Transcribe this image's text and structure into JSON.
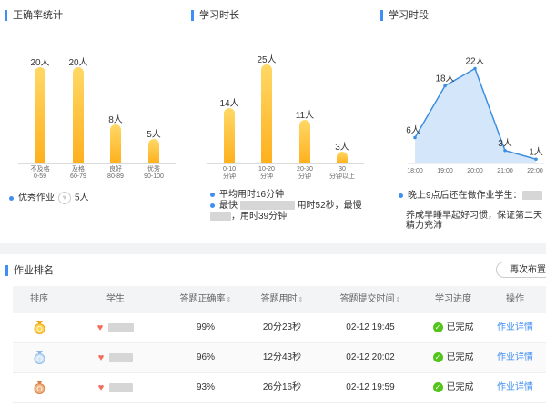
{
  "stats": {
    "accuracy": {
      "title": "正确率统计",
      "chart_data": {
        "type": "bar",
        "categories": [
          [
            "不及格",
            "0-59"
          ],
          [
            "及格",
            "60-79"
          ],
          [
            "良好",
            "80-89"
          ],
          [
            "优秀",
            "90-100"
          ]
        ],
        "values": [
          20,
          20,
          8,
          5
        ],
        "labels": [
          "20人",
          "20人",
          "8人",
          "5人"
        ],
        "ylim": [
          0,
          22
        ]
      },
      "footer": {
        "label": "优秀作业",
        "count": "5人"
      }
    },
    "duration": {
      "title": "学习时长",
      "chart_data": {
        "type": "bar",
        "categories": [
          [
            "0-10",
            "分钟"
          ],
          [
            "10-20",
            "分钟"
          ],
          [
            "20-30",
            "分钟"
          ],
          [
            "30",
            "分钟以上"
          ]
        ],
        "values": [
          14,
          25,
          11,
          3
        ],
        "labels": [
          "14人",
          "25人",
          "11人",
          "3人"
        ],
        "ylim": [
          0,
          27
        ]
      },
      "footer": {
        "average": "平均用时16分钟",
        "fastest_prefix": "最快",
        "fastest_time": "用时52秒，最慢",
        "slowest_time": "，用时39分钟"
      }
    },
    "timeslot": {
      "title": "学习时段",
      "chart_data": {
        "type": "area",
        "x": [
          "18:00",
          "19:00",
          "20:00",
          "21:00",
          "22:00"
        ],
        "values": [
          6,
          18,
          22,
          3,
          1
        ],
        "labels": [
          "6人",
          "18人",
          "22人",
          "3人",
          "1人"
        ],
        "ylim": [
          0,
          24
        ]
      },
      "footer": {
        "late_label": "晚上9点后还在做作业学生：",
        "tip": "养成早睡早起好习惯，保证第二天精力充沛"
      }
    }
  },
  "ranking": {
    "title": "作业排名",
    "reassign_label": "再次布置",
    "headers": [
      "排序",
      "学生",
      "答题正确率",
      "答题用时",
      "答题提交时间",
      "学习进度",
      "操作"
    ],
    "sort_mark": "⇕",
    "rows": [
      {
        "medal": "gold-medal-icon",
        "accuracy": "99%",
        "duration": "20分23秒",
        "submitted": "02-12 19:45",
        "progress": "已完成",
        "action": "作业详情"
      },
      {
        "medal": "silver-medal-icon",
        "accuracy": "96%",
        "duration": "12分43秒",
        "submitted": "02-12 20:02",
        "progress": "已完成",
        "action": "作业详情"
      },
      {
        "medal": "bronze-medal-icon",
        "accuracy": "93%",
        "duration": "26分16秒",
        "submitted": "02-12 19:59",
        "progress": "已完成",
        "action": "作业详情"
      }
    ]
  },
  "colors": {
    "accent": "#3f8ef5",
    "bar": "#ffb01e",
    "line": "#3c8fe0",
    "area": "#d3e6fa",
    "success": "#52c41a",
    "heart": "#f26d5a"
  }
}
